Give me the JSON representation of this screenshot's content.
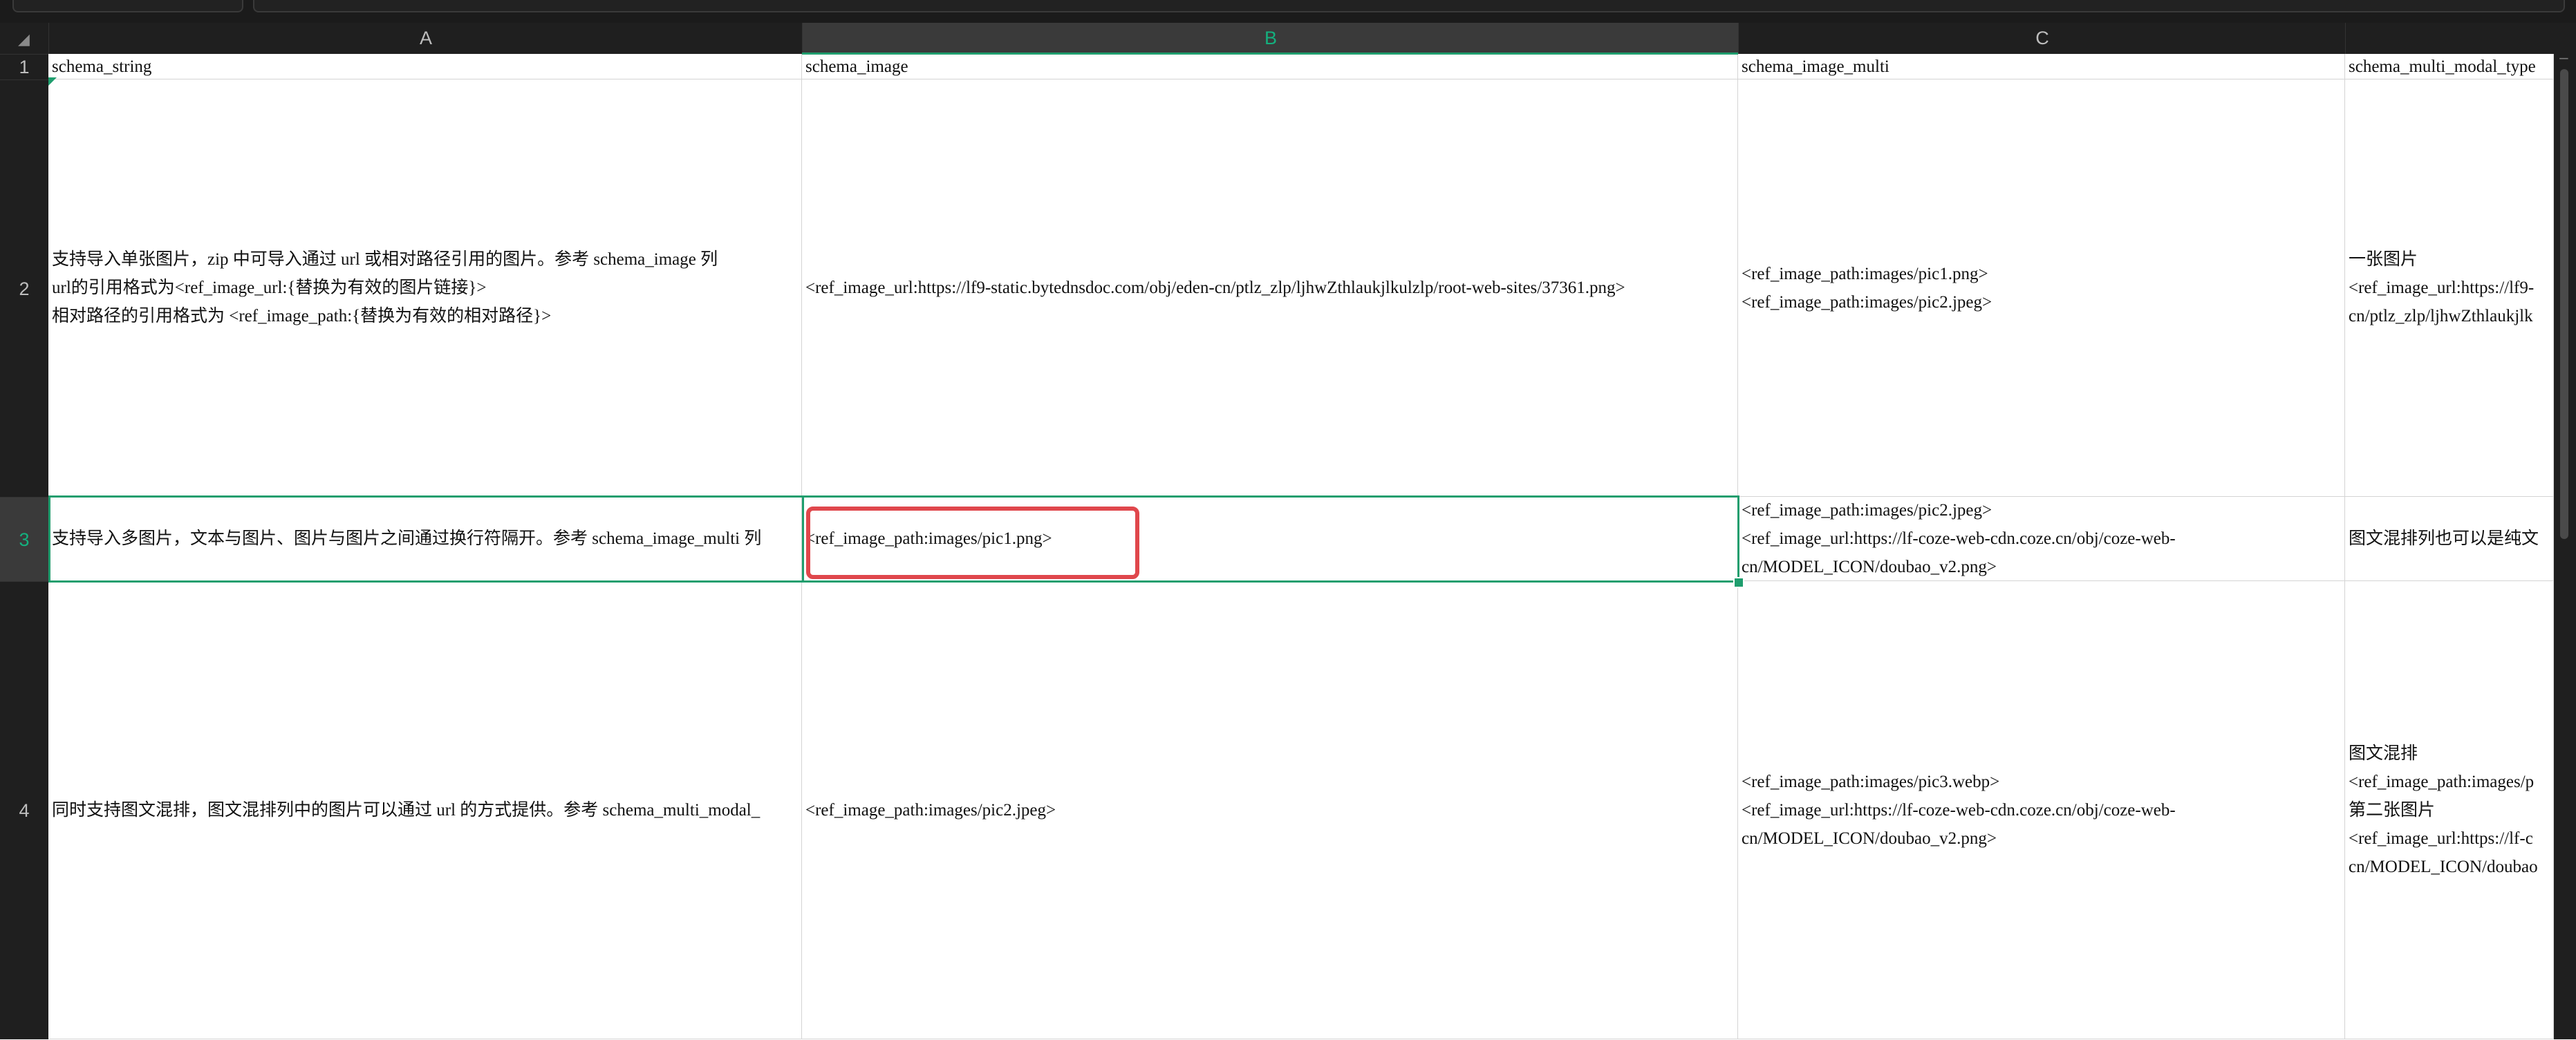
{
  "columns": [
    "A",
    "B",
    "C"
  ],
  "rows": [
    "1",
    "2",
    "3",
    "4"
  ],
  "cells": {
    "A1": "schema_string",
    "B1": "schema_image",
    "C1": "schema_image_multi",
    "D1": "schema_multi_modal_type",
    "A2": [
      "支持导入单张图片，zip 中可导入通过 url 或相对路径引用的图片。参考 schema_image 列",
      "url的引用格式为<ref_image_url:{替换为有效的图片链接}>",
      "相对路径的引用格式为 <ref_image_path:{替换为有效的相对路径}>"
    ],
    "B2": "<ref_image_url:https://lf9-static.bytednsdoc.com/obj/eden-cn/ptlz_zlp/ljhwZthlaukjlkulzlp/root-web-sites/37361.png>",
    "C2": [
      "<ref_image_path:images/pic1.png>",
      "<ref_image_path:images/pic2.jpeg>"
    ],
    "D2": [
      "一张图片",
      "<ref_image_url:https://lf9-",
      "cn/ptlz_zlp/ljhwZthlaukjlk"
    ],
    "A3": "支持导入多图片，文本与图片、图片与图片之间通过换行符隔开。参考 schema_image_multi 列",
    "B3": "<ref_image_path:images/pic1.png>",
    "C3": [
      "<ref_image_path:images/pic2.jpeg>",
      "<ref_image_url:https://lf-coze-web-cdn.coze.cn/obj/coze-web-",
      "cn/MODEL_ICON/doubao_v2.png>"
    ],
    "D3": "图文混排列也可以是纯文",
    "A4": "同时支持图文混排，图文混排列中的图片可以通过 url 的方式提供。参考 schema_multi_modal_",
    "B4": "<ref_image_path:images/pic2.jpeg>",
    "C4": [
      "<ref_image_path:images/pic3.webp>",
      "<ref_image_url:https://lf-coze-web-cdn.coze.cn/obj/coze-web-",
      "cn/MODEL_ICON/doubao_v2.png>"
    ],
    "D4": [
      "图文混排",
      "<ref_image_path:images/p",
      "第二张图片",
      "<ref_image_url:https://lf-c",
      "cn/MODEL_ICON/doubao"
    ]
  },
  "colors": {
    "accent": "#1f9e6e",
    "annotation": "#e0474c",
    "header_bg": "#1f1f1f"
  }
}
